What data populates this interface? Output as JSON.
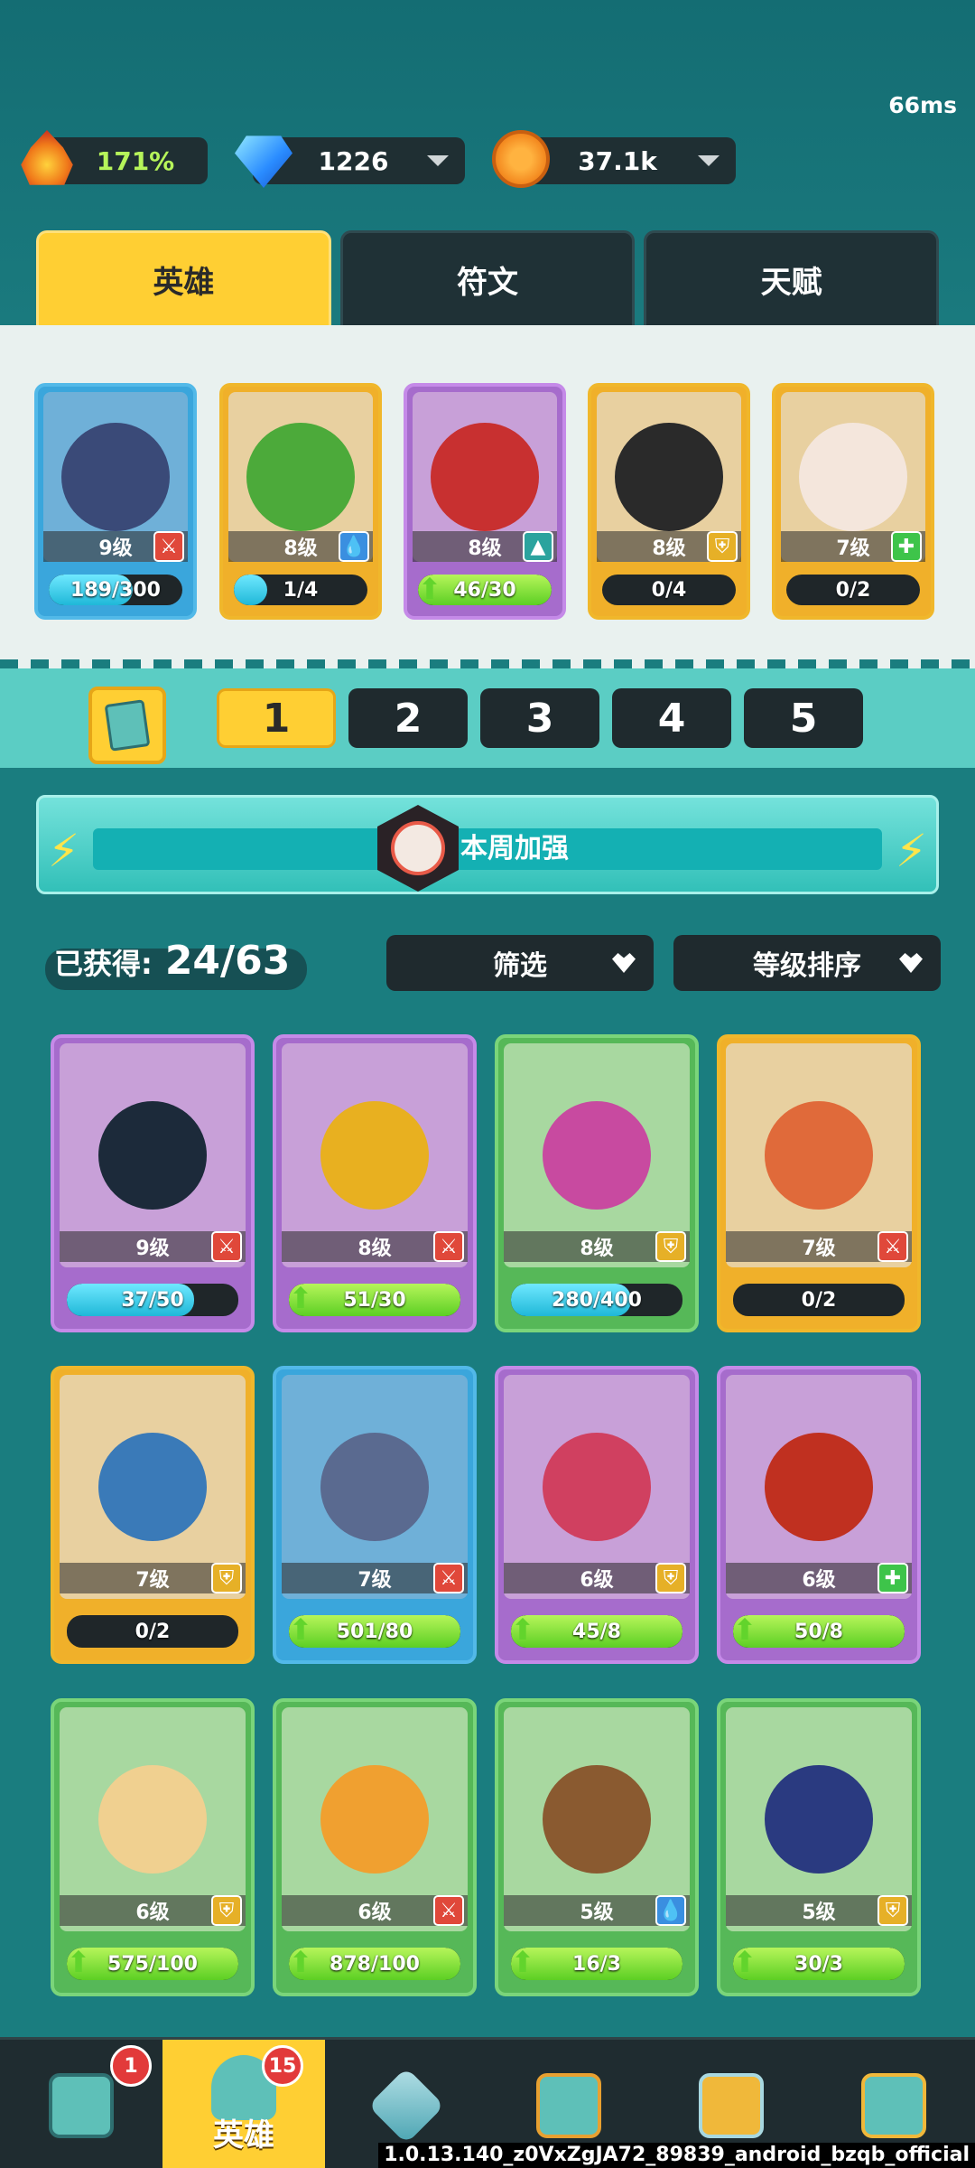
{
  "header": {
    "ping": "66ms",
    "resources": [
      {
        "name": "power",
        "value": "171%",
        "color": "#b6f55a",
        "icon": "flame-icon"
      },
      {
        "name": "gems",
        "value": "1226",
        "color": "#ffffff",
        "icon": "diamond-icon"
      },
      {
        "name": "coins",
        "value": "37.1k",
        "color": "#ffffff",
        "icon": "paw-coin-icon"
      }
    ],
    "tabs": [
      "英雄",
      "符文",
      "天赋"
    ]
  },
  "team": [
    {
      "level": "9级",
      "progress": "189/300",
      "fill": 0.63,
      "color": "blue",
      "role": "atk",
      "upgrade": false
    },
    {
      "level": "8级",
      "progress": "1/4",
      "fill": 0.25,
      "color": "gold",
      "role": "mag",
      "upgrade": false
    },
    {
      "level": "8级",
      "progress": "46/30",
      "fill": 1.0,
      "color": "purple",
      "role": "agi",
      "upgrade": true
    },
    {
      "level": "8级",
      "progress": "0/4",
      "fill": 0,
      "color": "gold",
      "role": "def",
      "upgrade": false
    },
    {
      "level": "7级",
      "progress": "0/2",
      "fill": 0,
      "color": "gold",
      "role": "heal",
      "upgrade": false
    }
  ],
  "pages": [
    "1",
    "2",
    "3",
    "4",
    "5"
  ],
  "banner": {
    "title": "本周加强"
  },
  "collection": {
    "label": "已获得:",
    "count": "24/63",
    "filter": "筛选",
    "sort": "等级排序"
  },
  "heroes": [
    {
      "level": "9级",
      "progress": "37/50",
      "fill": 0.74,
      "color": "purple",
      "role": "atk",
      "upgrade": false
    },
    {
      "level": "8级",
      "progress": "51/30",
      "fill": 1.0,
      "color": "purple",
      "role": "atk",
      "upgrade": true
    },
    {
      "level": "8级",
      "progress": "280/400",
      "fill": 0.7,
      "color": "green",
      "role": "def",
      "upgrade": false
    },
    {
      "level": "7级",
      "progress": "0/2",
      "fill": 0,
      "color": "gold",
      "role": "atk",
      "upgrade": false
    },
    {
      "level": "7级",
      "progress": "0/2",
      "fill": 0,
      "color": "gold",
      "role": "def",
      "upgrade": false
    },
    {
      "level": "7级",
      "progress": "501/80",
      "fill": 1.0,
      "color": "blue",
      "role": "atk",
      "upgrade": true
    },
    {
      "level": "6级",
      "progress": "45/8",
      "fill": 1.0,
      "color": "purple",
      "role": "def",
      "upgrade": true
    },
    {
      "level": "6级",
      "progress": "50/8",
      "fill": 1.0,
      "color": "purple",
      "role": "heal",
      "upgrade": true
    },
    {
      "level": "6级",
      "progress": "575/100",
      "fill": 1.0,
      "color": "green",
      "role": "def",
      "upgrade": true
    },
    {
      "level": "6级",
      "progress": "878/100",
      "fill": 1.0,
      "color": "green",
      "role": "atk",
      "upgrade": true
    },
    {
      "level": "5级",
      "progress": "16/3",
      "fill": 1.0,
      "color": "green",
      "role": "mag",
      "upgrade": true
    },
    {
      "level": "5级",
      "progress": "30/3",
      "fill": 1.0,
      "color": "green",
      "role": "def",
      "upgrade": true
    }
  ],
  "nav": {
    "items": [
      {
        "name": "shop-icon",
        "badge": "1"
      },
      {
        "name": "hero-icon",
        "label": "英雄",
        "badge": "15"
      },
      {
        "name": "swords-icon"
      },
      {
        "name": "gift-icon"
      },
      {
        "name": "quest-cards-icon"
      },
      {
        "name": "guild-banner-icon"
      }
    ]
  },
  "footer": {
    "version": "1.0.13.140_z0VxZgJA72_89839_android_bzqb_official"
  }
}
